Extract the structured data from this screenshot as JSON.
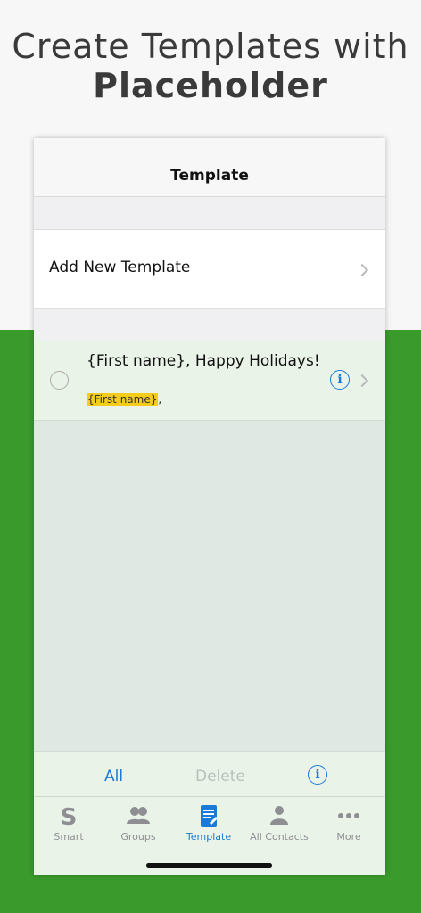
{
  "headline": {
    "line1": "Create Templates with",
    "line2": "Placeholder"
  },
  "navbar": {
    "title": "Template"
  },
  "add_row": {
    "label": "Add New Template"
  },
  "templates": [
    {
      "title": "{First name}, Happy Holidays!",
      "preview_placeholder": "{First name}",
      "preview_rest": ","
    }
  ],
  "toolbar": {
    "all_label": "All",
    "delete_label": "Delete"
  },
  "tabs": [
    {
      "label": "Smart",
      "icon": "smart-s-icon",
      "active": false
    },
    {
      "label": "Groups",
      "icon": "groups-icon",
      "active": false
    },
    {
      "label": "Template",
      "icon": "template-doc-icon",
      "active": true
    },
    {
      "label": "All Contacts",
      "icon": "person-icon",
      "active": false
    },
    {
      "label": "More",
      "icon": "more-dots-icon",
      "active": false
    }
  ],
  "colors": {
    "accent": "#1a7ad8",
    "highlight": "#f5cc1c",
    "background_green": "#3a9a2c",
    "tab_inactive": "#8e8e93"
  }
}
